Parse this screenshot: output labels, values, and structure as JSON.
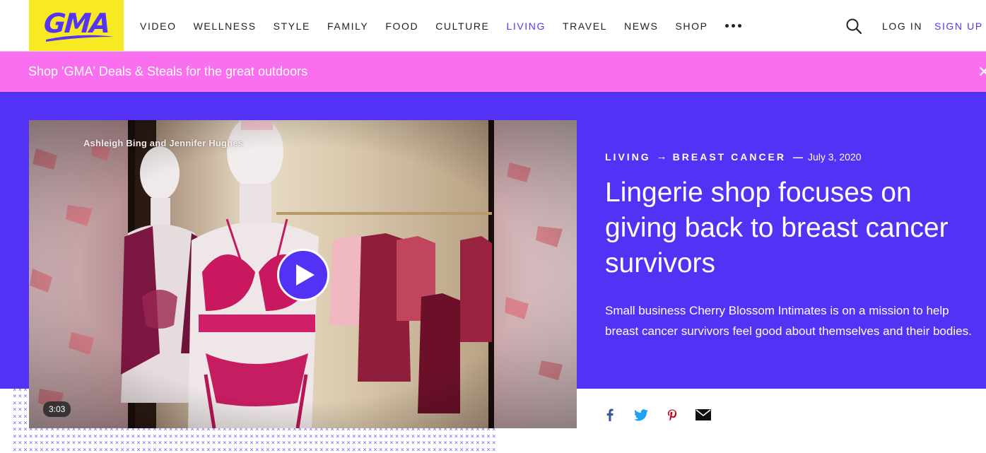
{
  "header": {
    "logo_text": "GMA",
    "nav": [
      {
        "label": "VIDEO"
      },
      {
        "label": "WELLNESS"
      },
      {
        "label": "STYLE"
      },
      {
        "label": "FAMILY"
      },
      {
        "label": "FOOD"
      },
      {
        "label": "CULTURE"
      },
      {
        "label": "LIVING",
        "active": true
      },
      {
        "label": "TRAVEL"
      },
      {
        "label": "NEWS"
      },
      {
        "label": "SHOP"
      }
    ],
    "more_icon": "more-dots-icon",
    "search_icon": "search-icon",
    "login_label": "LOG IN",
    "signup_label": "SIGN UP"
  },
  "promo": {
    "text": "Shop 'GMA' Deals & Steals for the great outdoors",
    "close_icon": "close-icon"
  },
  "video": {
    "caption": "Ashleigh Bing and Jennifer Hughes",
    "duration": "3:03",
    "play_icon": "play-icon"
  },
  "article": {
    "category": "LIVING",
    "subcategory": "BREAST CANCER",
    "arrow": "→",
    "separator": "—",
    "date": "July 3, 2020",
    "headline": "Lingerie shop focuses on giving back to breast cancer survivors",
    "dek": "Small business Cherry Blossom Intimates is on a mission to help breast cancer survivors feel good about themselves and their bodies."
  },
  "share": {
    "icons": [
      "facebook-icon",
      "twitter-icon",
      "pinterest-icon",
      "email-icon"
    ]
  },
  "colors": {
    "brand_purple": "#5432f5",
    "logo_yellow": "#f8ea22",
    "promo_pink": "#fa6ef0",
    "facebook": "#3b5998",
    "twitter": "#1da1f2",
    "pinterest": "#bd081c"
  }
}
